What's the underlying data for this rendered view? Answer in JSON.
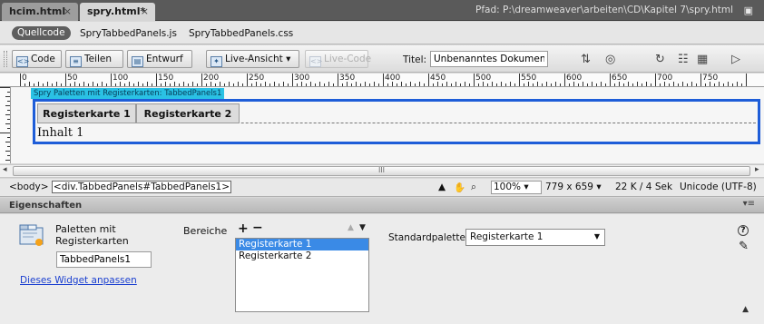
{
  "tabs": [
    {
      "label": "hcim.html",
      "close": "×"
    },
    {
      "label": "spry.html*",
      "close": "×"
    }
  ],
  "path": "Pfad: P:\\dreamweaver\\arbeiten\\CD\\Kapitel 7\\spry.html",
  "related_files": {
    "source": "Quellcode",
    "files": [
      "SpryTabbedPanels.js",
      "SpryTabbedPanels.css"
    ]
  },
  "toolbar": {
    "code": "Code",
    "split": "Teilen",
    "design": "Entwurf",
    "live_view": "Live-Ansicht",
    "live_code": "Live-Code",
    "title_label": "Titel:",
    "title_value": "Unbenanntes Dokument"
  },
  "ruler": {
    "marks": [
      "0",
      "50",
      "100",
      "150",
      "200",
      "250",
      "300",
      "350",
      "400",
      "450",
      "500",
      "550",
      "600",
      "650",
      "700",
      "750"
    ]
  },
  "canvas": {
    "widget_label": "Spry Paletten mit Registerkarten: TabbedPanels1",
    "tabs": [
      "Registerkarte 1",
      "Registerkarte 2"
    ],
    "content": "Inhalt 1"
  },
  "scrollbar": {
    "thumb_grip": "III"
  },
  "statusbar": {
    "body_tag": "<body>",
    "selected_tag": "<div.TabbedPanels#TabbedPanels1>",
    "zoom": "100%",
    "dimensions": "779 x 659",
    "size_time": "22 K / 4 Sek",
    "encoding": "Unicode (UTF-8)"
  },
  "properties": {
    "header": "Eigenschaften",
    "widget_type": "Paletten mit Registerkarten",
    "widget_name": "TabbedPanels1",
    "customize_link": "Dieses Widget anpassen",
    "panels_label": "Bereiche",
    "panels": [
      "Registerkarte 1",
      "Registerkarte 2"
    ],
    "selected_panel": 0,
    "default_label": "Standardpalette",
    "default_value": "Registerkarte 1"
  },
  "colors": {
    "widget_border": "#1e5dd8",
    "widget_label_bg": "#2ac1e4",
    "selection": "#3a8ae6",
    "link": "#1a3fd0"
  }
}
